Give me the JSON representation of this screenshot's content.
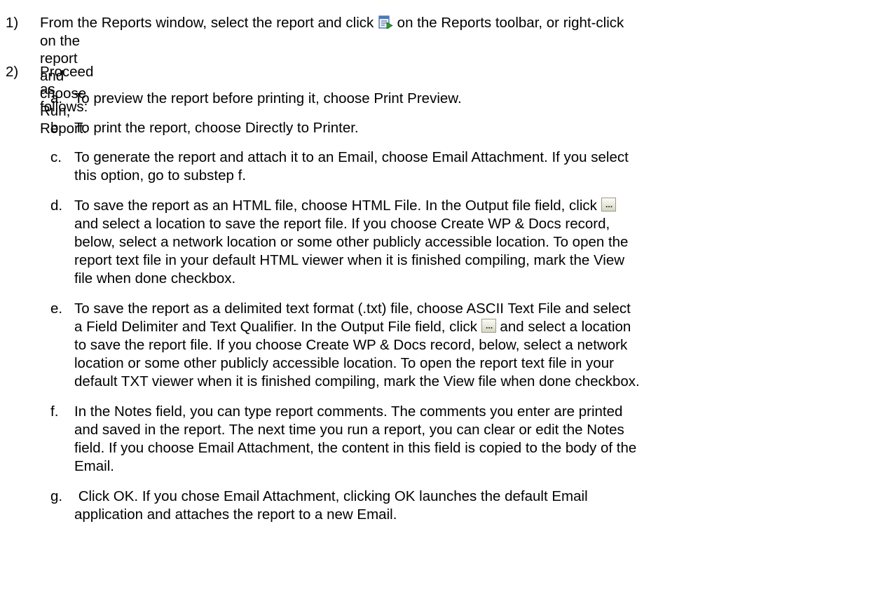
{
  "step1": {
    "number": "1)",
    "line1_before_icon": "From the Reports window, select the report and click",
    "run_icon": "run-report-icon",
    "line1_after_icon": "on the Reports toolbar, or right-click",
    "line2": "on the report and choose Run, Report."
  },
  "step2": {
    "number": "2)",
    "text": "Proceed as follows:"
  },
  "substeps": {
    "a": {
      "letter": "a.",
      "lines": [
        "To preview the report before printing it, choose Print Preview."
      ]
    },
    "b": {
      "letter": "b.",
      "lines": [
        "To print the report, choose Directly to Printer."
      ]
    },
    "c": {
      "letter": "c.",
      "lines": [
        "To generate the report and attach it to an Email, choose Email Attachment. If you select",
        "this option, go to substep f."
      ]
    },
    "d": {
      "letter": "d.",
      "line1_before_icon": "To save the report as an HTML file, choose HTML File. In the Output file field, click",
      "browse_icon": "browse-button-icon",
      "lines_rest": [
        "and select a location to save the report file. If you choose Create WP & Docs record,",
        "below, select a network location or some other publicly accessible location. To open the",
        "report text file in your default HTML viewer when it is finished compiling, mark the View",
        "file when done checkbox."
      ]
    },
    "e": {
      "letter": "e.",
      "line1": "To save the report as a delimited text format (.txt) file, choose ASCII Text File and select",
      "line2_before_icon": "a Field Delimiter and Text Qualifier. In the Output File field, click",
      "line2_after_icon": "and select a location",
      "lines_rest": [
        "to save the report file. If you choose Create WP & Docs record, below, select a network",
        "location or some other publicly accessible location. To open the report text file in your",
        "default TXT viewer when it is finished compiling, mark the View file when done checkbox."
      ]
    },
    "f": {
      "letter": "f.",
      "lines": [
        "In the Notes field, you can type report comments. The comments you enter are printed",
        "and saved in the report. The next time you run a report, you can clear or edit the Notes",
        "field. If you choose Email Attachment, the content in this field is copied to the body of the",
        "Email."
      ]
    },
    "g": {
      "letter": "g.",
      "lines": [
        " Click OK. If you chose Email Attachment, clicking OK launches the default Email",
        "application and attaches the report to a new Email."
      ]
    }
  }
}
